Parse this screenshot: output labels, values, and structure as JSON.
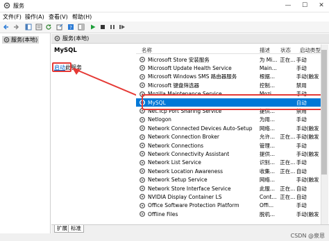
{
  "window": {
    "title": "服务"
  },
  "menu": [
    "文件(F)",
    "操作(A)",
    "查看(V)",
    "帮助(H)"
  ],
  "tree": {
    "root": "服务(本地)"
  },
  "right_header": {
    "title": "服务(本地)"
  },
  "desc": {
    "service_name": "MySQL",
    "start_link": "启动",
    "start_suffix": "此服务"
  },
  "columns": {
    "name": "名称",
    "desc": "描述",
    "status": "状态",
    "startup": "启动类型"
  },
  "rows": [
    {
      "name": "Microsoft Store 安装服务",
      "desc": "为 Mi...",
      "status": "正在...",
      "startup": "手动"
    },
    {
      "name": "Microsoft Update Health Service",
      "desc": "Main...",
      "status": "",
      "startup": "手动"
    },
    {
      "name": "Microsoft Windows SMS 路由器服务",
      "desc": "根据...",
      "status": "",
      "startup": "手动(触发"
    },
    {
      "name": "Microsoft 键盘筛选器",
      "desc": "控制...",
      "status": "",
      "startup": "禁用"
    },
    {
      "name": "Mozilla Maintenance Service",
      "desc": "Mozi...",
      "status": "",
      "startup": "手动"
    },
    {
      "name": "MySQL",
      "desc": "",
      "status": "",
      "startup": "自动",
      "selected": true
    },
    {
      "name": "Net.Tcp Port Sharing Service",
      "desc": "提供...",
      "status": "",
      "startup": "禁用"
    },
    {
      "name": "Netlogon",
      "desc": "为用...",
      "status": "",
      "startup": "手动"
    },
    {
      "name": "Network Connected Devices Auto-Setup",
      "desc": "网络...",
      "status": "",
      "startup": "手动(触发"
    },
    {
      "name": "Network Connection Broker",
      "desc": "允许...",
      "status": "正在...",
      "startup": "手动(触发"
    },
    {
      "name": "Network Connections",
      "desc": "管理...",
      "status": "",
      "startup": "手动"
    },
    {
      "name": "Network Connectivity Assistant",
      "desc": "提供...",
      "status": "",
      "startup": "手动(触发"
    },
    {
      "name": "Network List Service",
      "desc": "识别...",
      "status": "正在...",
      "startup": "手动"
    },
    {
      "name": "Network Location Awareness",
      "desc": "收集...",
      "status": "正在...",
      "startup": "自动"
    },
    {
      "name": "Network Setup Service",
      "desc": "网络...",
      "status": "",
      "startup": "手动(触发"
    },
    {
      "name": "Network Store Interface Service",
      "desc": "此服...",
      "status": "正在...",
      "startup": "自动"
    },
    {
      "name": "NVIDIA Display Container LS",
      "desc": "Cont...",
      "status": "正在...",
      "startup": "自动"
    },
    {
      "name": "Office Software Protection Platform",
      "desc": "Offi...",
      "status": "",
      "startup": "手动"
    },
    {
      "name": "Offline Files",
      "desc": "脱机...",
      "status": "",
      "startup": "手动(触发"
    }
  ],
  "tabs": [
    "扩展",
    "标准"
  ],
  "watermark": "CSDN @泉恩",
  "colors": {
    "selection": "#0078d7",
    "annotation": "#e53935",
    "link": "#0066cc"
  }
}
